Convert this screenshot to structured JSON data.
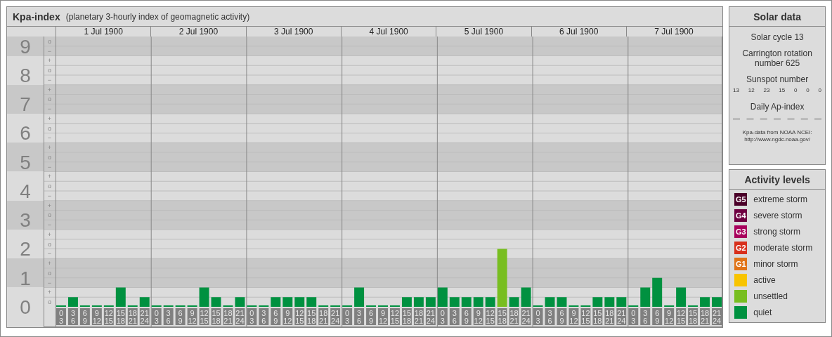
{
  "kp_panel": {
    "title": "Kpa-index",
    "subtitle": "(planetary 3-hourly index of geomagnetic activity)",
    "dates": [
      "1 Jul 1900",
      "2 Jul 1900",
      "3 Jul 1900",
      "4 Jul 1900",
      "5 Jul 1900",
      "6 Jul 1900",
      "7 Jul 1900"
    ],
    "scale": [
      {
        "marks": [
          "o",
          "−"
        ]
      },
      {
        "marks": [
          "+",
          "o",
          "−"
        ]
      },
      {
        "marks": [
          "+",
          "o",
          "−"
        ]
      },
      {
        "marks": [
          "+",
          "o",
          "−"
        ]
      },
      {
        "marks": [
          "+",
          "o",
          "−"
        ]
      },
      {
        "marks": [
          "+",
          "o",
          "−"
        ]
      },
      {
        "marks": [
          "+",
          "o",
          "−"
        ]
      },
      {
        "marks": [
          "+",
          "o",
          "−"
        ]
      },
      {
        "marks": [
          "+",
          "o",
          "−"
        ]
      },
      {
        "marks": [
          "+",
          "o"
        ]
      }
    ],
    "chart_data": {
      "type": "bar",
      "ylim": [
        0,
        9.33
      ],
      "yticks": [
        0,
        1,
        2,
        3,
        4,
        5,
        6,
        7,
        8,
        9
      ],
      "grid": true,
      "categories": [
        "0\n3",
        "3\n6",
        "6\n9",
        "9\n12",
        "12\n15",
        "15\n18",
        "18\n21",
        "21\n24",
        "0\n3",
        "3\n6",
        "6\n9",
        "9\n12",
        "12\n15",
        "15\n18",
        "18\n21",
        "21\n24",
        "0\n3",
        "3\n6",
        "6\n9",
        "9\n12",
        "12\n15",
        "15\n18",
        "18\n21",
        "21\n24",
        "0\n3",
        "3\n6",
        "6\n9",
        "9\n12",
        "12\n15",
        "15\n18",
        "18\n21",
        "21\n24",
        "0\n3",
        "3\n6",
        "6\n9",
        "9\n12",
        "12\n15",
        "15\n18",
        "18\n21",
        "21\n24",
        "0\n3",
        "3\n6",
        "6\n9",
        "9\n12",
        "12\n15",
        "15\n18",
        "18\n21",
        "21\n24",
        "0\n3",
        "3\n6",
        "6\n9",
        "9\n12",
        "12\n15",
        "15\n18",
        "18\n21",
        "21\n24"
      ],
      "values": [
        0,
        0.33,
        0,
        0,
        0,
        0.67,
        0,
        0.33,
        0,
        0,
        0,
        0,
        0.67,
        0.33,
        0,
        0.33,
        0,
        0,
        0.33,
        0.33,
        0.33,
        0.33,
        0,
        0,
        0,
        0.67,
        0,
        0,
        0,
        0.33,
        0.33,
        0.33,
        0.67,
        0.33,
        0.33,
        0.33,
        0.33,
        2,
        0.33,
        0.67,
        0,
        0.33,
        0.33,
        0,
        0,
        0.33,
        0.33,
        0.33,
        0,
        0.67,
        1,
        0,
        0.67,
        0,
        0.33,
        0.33
      ]
    }
  },
  "solar_data": {
    "title": "Solar data",
    "solar_cycle": "Solar cycle 13",
    "carrington": "Carrington rotation number 625",
    "sunspot_heading": "Sunspot number",
    "sunspot_numbers": [
      "13",
      "12",
      "23",
      "15",
      "0",
      "0",
      "0"
    ],
    "ap_heading": "Daily Ap-index",
    "ap_values": [
      "—",
      "—",
      "—",
      "—",
      "—",
      "—",
      "—"
    ],
    "source": "Kpa-data from NOAA NCEI:",
    "source_url": "http://www.ngdc.noaa.gov/"
  },
  "activity_levels": {
    "title": "Activity levels",
    "items": [
      {
        "badge": "G5",
        "label": "extreme storm",
        "color": "#4a0028"
      },
      {
        "badge": "G4",
        "label": "severe storm",
        "color": "#6e0040"
      },
      {
        "badge": "G3",
        "label": "strong storm",
        "color": "#a8005c"
      },
      {
        "badge": "G2",
        "label": "moderate storm",
        "color": "#d8301c"
      },
      {
        "badge": "G1",
        "label": "minor storm",
        "color": "#e07418"
      },
      {
        "label": "active",
        "color": "#f8c400"
      },
      {
        "label": "unsettled",
        "color": "#78be20"
      },
      {
        "label": "quiet",
        "color": "#009140"
      }
    ]
  }
}
